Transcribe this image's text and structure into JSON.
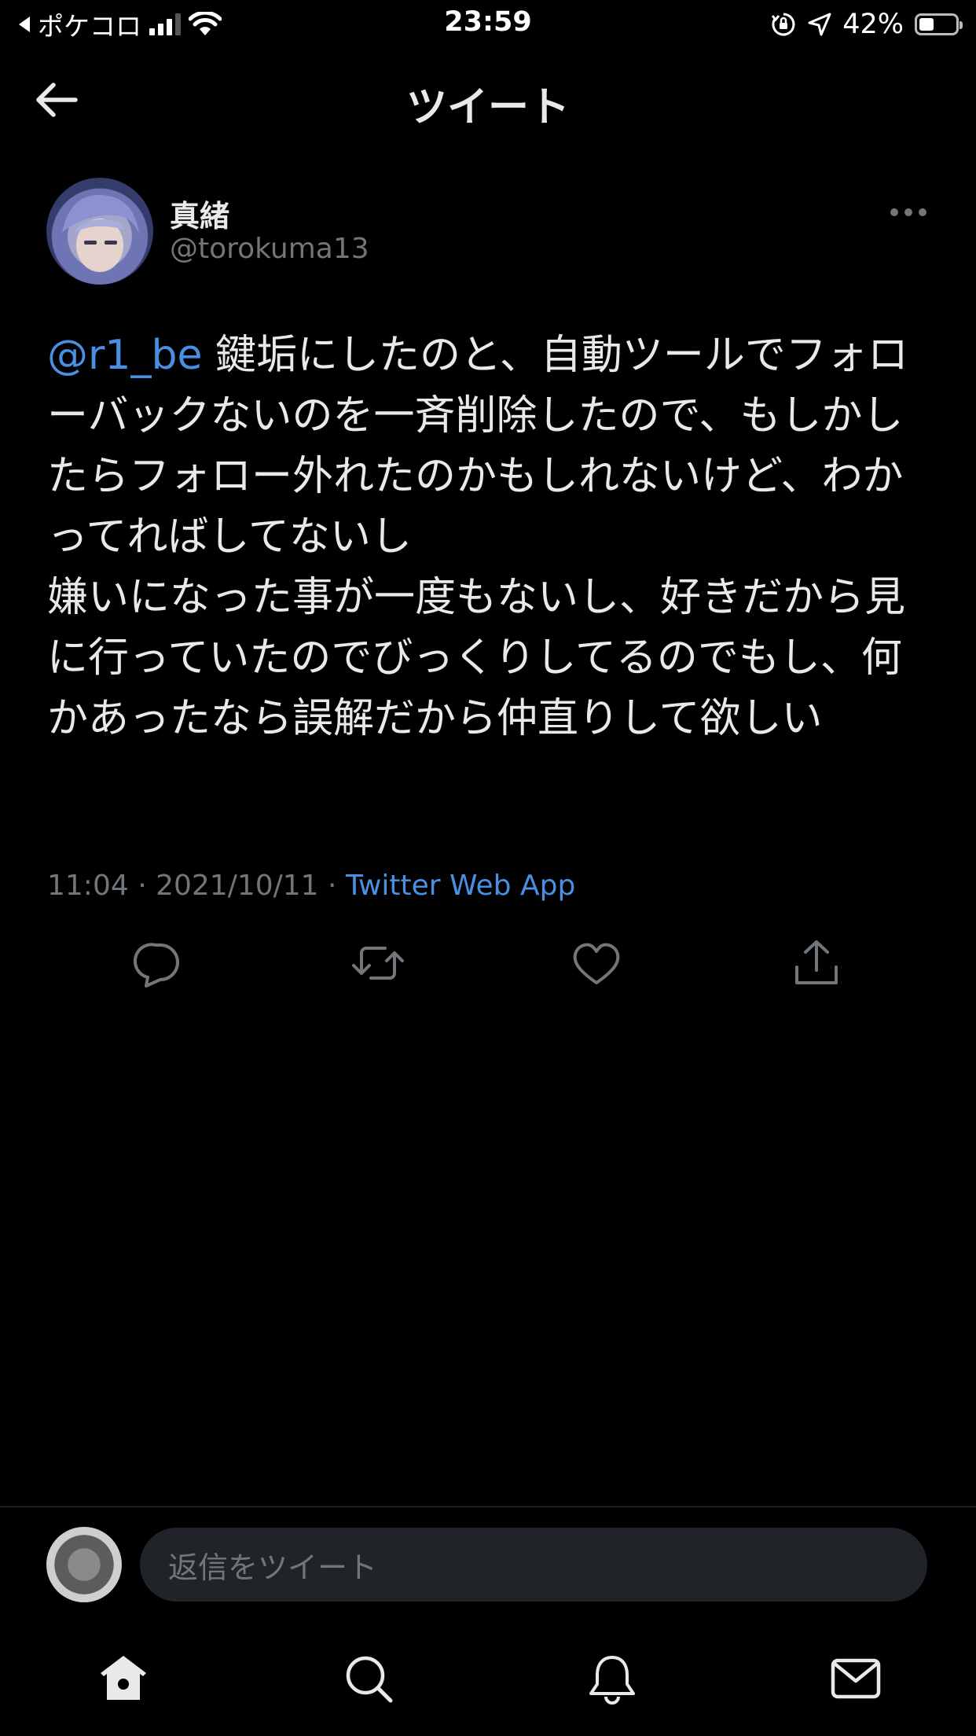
{
  "status_bar": {
    "back_app": "ポケコロ",
    "time": "23:59",
    "battery_percent": "42%",
    "battery_level": 0.42,
    "signal_bars": 3
  },
  "header": {
    "title": "ツイート"
  },
  "tweet": {
    "author_name": "真緒",
    "author_handle": "@torokuma13",
    "mention": "@r1_be",
    "text": " 鍵垢にしたのと、自動ツールでフォローバックないのを一斉削除したので、もしかしたらフォロー外れたのかもしれないけど、わかってればしてないし\n嫌いになった事が一度もないし、好きだから見に行っていたのでびっくりしてるのでもし、何かあったなら誤解だから仲直りして欲しい",
    "time": "11:04",
    "separator": " · ",
    "date": "2021/10/11",
    "source": "Twitter Web App"
  },
  "actions": [
    "reply-icon",
    "retweet-icon",
    "like-icon",
    "share-icon"
  ],
  "reply_bar": {
    "placeholder": "返信をツイート"
  },
  "tabbar": [
    "home-icon",
    "search-icon",
    "notifications-icon",
    "messages-icon"
  ],
  "colors": {
    "background": "#000000",
    "text": "#e7e9ea",
    "secondary": "#71767b",
    "accent": "#4a90e2"
  }
}
